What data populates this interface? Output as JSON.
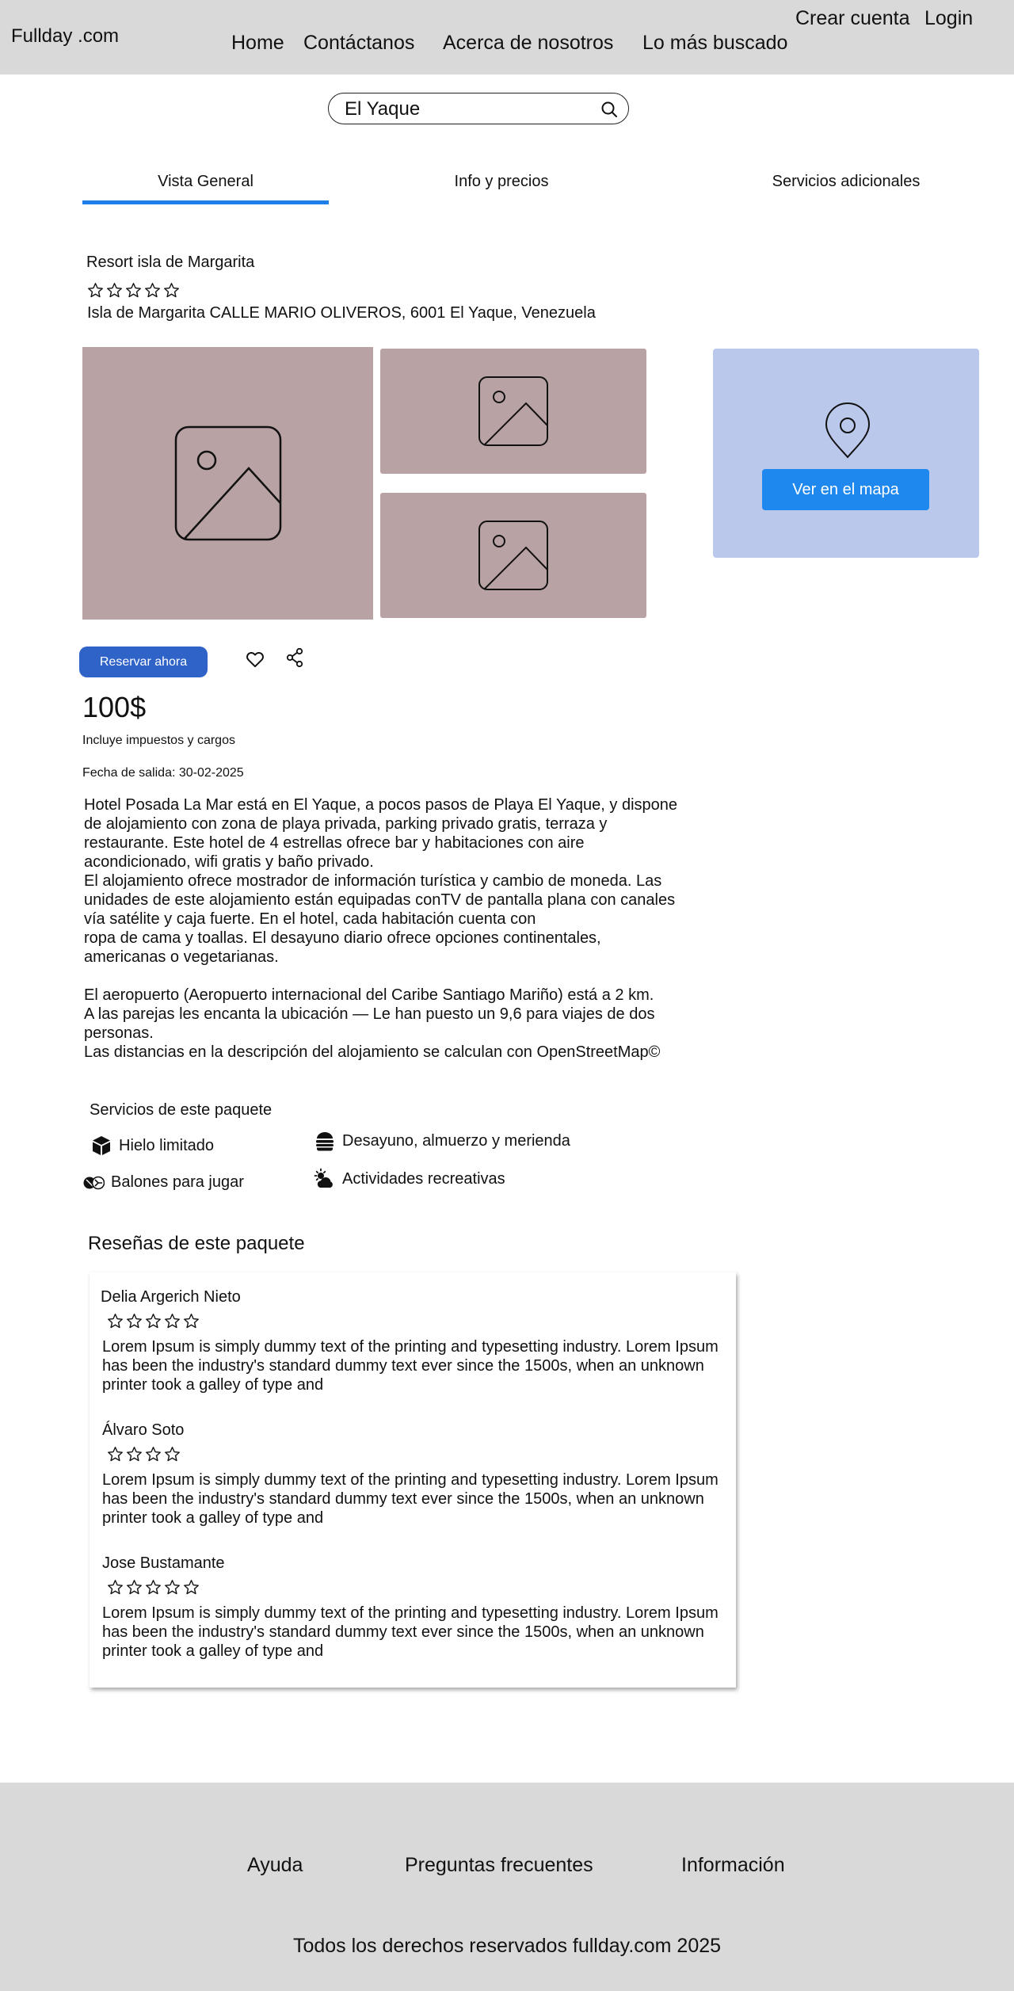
{
  "header": {
    "logo": "Fullday .com",
    "nav": [
      "Home",
      "Contáctanos",
      "Acerca de nosotros",
      "Lo más buscado"
    ],
    "create_account": "Crear cuenta",
    "login": "Login"
  },
  "search": {
    "value": "El Yaque",
    "icon": "search-icon"
  },
  "tabs": {
    "items": [
      "Vista General",
      "Info y precios",
      "Servicios adicionales"
    ],
    "active": "Vista General",
    "accent_color": "#1e7fe8"
  },
  "hotel": {
    "name": "Resort isla de Margarita",
    "stars": 5,
    "address": "Isla de Margarita CALLE MARIO OLIVEROS, 6001 El Yaque, Venezuela"
  },
  "gallery": {
    "placeholder_icon": "image-icon",
    "color": "#b9a2a4"
  },
  "map": {
    "button": "Ver en el mapa",
    "icon": "map-pin-icon"
  },
  "actions": {
    "reserve": "Reservar ahora",
    "favorite_icon": "heart-icon",
    "share_icon": "share-icon"
  },
  "price": {
    "amount": "100$",
    "note": "Incluye impuestos y cargos",
    "checkout": "Fecha de salida: 30-02-2025"
  },
  "description": "Hotel Posada La Mar está en El Yaque, a pocos pasos de Playa El Yaque, y dispone\nde alojamiento con zona de playa privada, parking privado gratis, terraza y\nrestaurante. Este hotel de 4 estrellas ofrece bar y habitaciones con aire\nacondicionado, wifi gratis y baño privado.\nEl alojamiento ofrece mostrador de información turística y cambio de moneda.  Las\nunidades de este alojamiento están equipadas conTV de pantalla plana con canales\nvía satélite y caja fuerte. En el hotel, cada habitación cuenta con\nropa de cama y toallas.  El desayuno diario ofrece opciones continentales,\namericanas o vegetarianas.\n\nEl aeropuerto (Aeropuerto internacional del Caribe Santiago Mariño) está a 2 km.\nA las parejas les encanta la ubicación — Le han puesto un 9,6 para viajes de dos\npersonas.\nLas distancias en la descripción del alojamiento se calculan con OpenStreetMap©",
  "services": {
    "title": "Servicios de este paquete",
    "items": [
      {
        "label": "Hielo limitado",
        "icon": "ice-cube-icon"
      },
      {
        "label": "Desayuno, almuerzo y merienda",
        "icon": "burger-icon"
      },
      {
        "label": "Balones para jugar",
        "icon": "balls-icon"
      },
      {
        "label": "Actividades recreativas",
        "icon": "sun-cloud-icon"
      }
    ]
  },
  "reviews": {
    "title": "Reseñas de este paquete",
    "items": [
      {
        "name": "Delia Argerich Nieto",
        "stars": 5,
        "text": "Lorem Ipsum is simply dummy text of the printing and typesetting industry. Lorem Ipsum has been the industry's standard dummy text ever since the 1500s, when an unknown printer took a galley of type and"
      },
      {
        "name": "Álvaro Soto",
        "stars": 4,
        "text": "Lorem Ipsum is simply dummy text of the printing and typesetting industry. Lorem Ipsum has been the industry's standard dummy text ever since the 1500s, when an unknown printer took a galley of type and"
      },
      {
        "name": "Jose Bustamante",
        "stars": 5,
        "text": "Lorem Ipsum is simply dummy text of the printing and typesetting industry. Lorem Ipsum has been the industry's standard dummy text ever since the 1500s, when an unknown printer took a galley of type and"
      }
    ]
  },
  "footer": {
    "links": [
      "Ayuda",
      "Preguntas frecuentes",
      "Información"
    ],
    "copyright": "Todos los derechos reservados fullday.com 2025"
  }
}
